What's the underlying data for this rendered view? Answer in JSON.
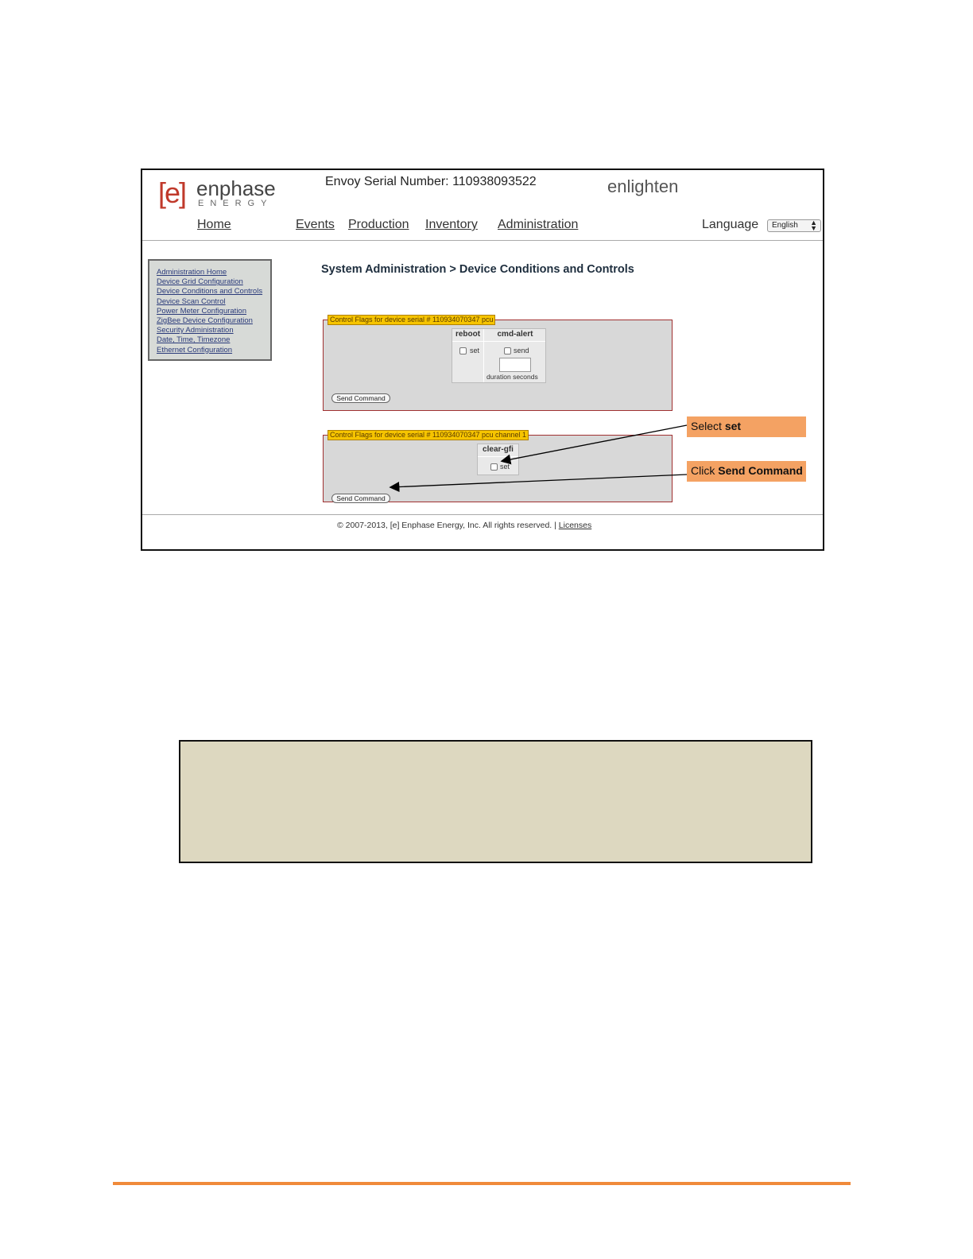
{
  "header": {
    "logo_bracket": "[e]",
    "logo_word": "enphase",
    "logo_sub": "ENERGY",
    "serial_label": "Envoy Serial Number: 110938093522",
    "enlighten": "enlighten"
  },
  "nav": {
    "home": "Home",
    "events": "Events",
    "production": "Production",
    "inventory": "Inventory",
    "administration": "Administration",
    "language_label": "Language",
    "language_value": "English"
  },
  "sidebar": {
    "items": [
      "Administration Home",
      "Device Grid Configuration",
      "Device Conditions and Controls",
      "Device Scan Control",
      "Power Meter Configuration",
      "ZigBee Device Configuration",
      "Security Administration",
      "Date, Time, Timezone",
      "Ethernet Configuration"
    ]
  },
  "main": {
    "title": "System Administration > Device Conditions and Controls",
    "panel1": {
      "legend": "Control Flags for device serial # 110934070347 pcu",
      "col_reboot": "reboot",
      "col_cmd_alert": "cmd-alert",
      "reboot_label": "set",
      "cmd_alert_label": "send",
      "duration_label": "duration seconds",
      "send_button": "Send Command"
    },
    "panel2": {
      "legend": "Control Flags for device serial # 110934070347 pcu channel 1",
      "col_clear_gfi": "clear-gfi",
      "clear_gfi_label": "set",
      "send_button": "Send Command"
    }
  },
  "callouts": {
    "select_prefix": "Select ",
    "select_bold": "set",
    "click_prefix": "Click ",
    "click_bold": "Send Command"
  },
  "footer": {
    "copyright": "© 2007-2013, [e] Enphase Energy, Inc. All rights reserved. | ",
    "licenses": "Licenses"
  },
  "colors": {
    "callout_bg": "#f4a263",
    "legend_bg": "#f6c400",
    "panel_border": "#a03030",
    "note_bg": "#ddd8c0",
    "rule": "#f08a3a"
  }
}
